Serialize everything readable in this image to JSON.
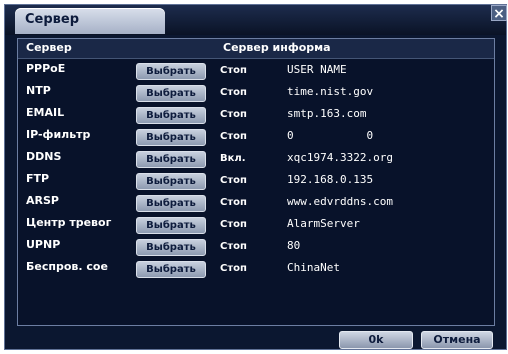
{
  "window": {
    "title": "Сервер",
    "close_label": "×"
  },
  "table": {
    "headers": {
      "service": "Сервер",
      "info": "Сервер информа"
    },
    "rows": [
      {
        "service": "PPPoE",
        "button": "Выбрать",
        "status": "Стоп",
        "info": "USER NAME"
      },
      {
        "service": "NTP",
        "button": "Выбрать",
        "status": "Стоп",
        "info": "time.nist.gov"
      },
      {
        "service": "EMAIL",
        "button": "Выбрать",
        "status": "Стоп",
        "info": "smtp.163.com"
      },
      {
        "service": "IP-фильтр",
        "button": "Выбрать",
        "status": "Стоп",
        "info": "0           0"
      },
      {
        "service": "DDNS",
        "button": "Выбрать",
        "status": "Вкл.",
        "info": "xqc1974.3322.org"
      },
      {
        "service": "FTP",
        "button": "Выбрать",
        "status": "Стоп",
        "info": "192.168.0.135"
      },
      {
        "service": "ARSP",
        "button": "Выбрать",
        "status": "Стоп",
        "info": "www.edvrddns.com"
      },
      {
        "service": "Центр тревог",
        "button": "Выбрать",
        "status": "Стоп",
        "info": "AlarmServer"
      },
      {
        "service": "UPNP",
        "button": "Выбрать",
        "status": "Стоп",
        "info": "80"
      },
      {
        "service": "Беспров. сое",
        "button": "Выбрать",
        "status": "Стоп",
        "info": "ChinaNet"
      }
    ]
  },
  "footer": {
    "ok_label": "0k",
    "cancel_label": "Отмена"
  }
}
